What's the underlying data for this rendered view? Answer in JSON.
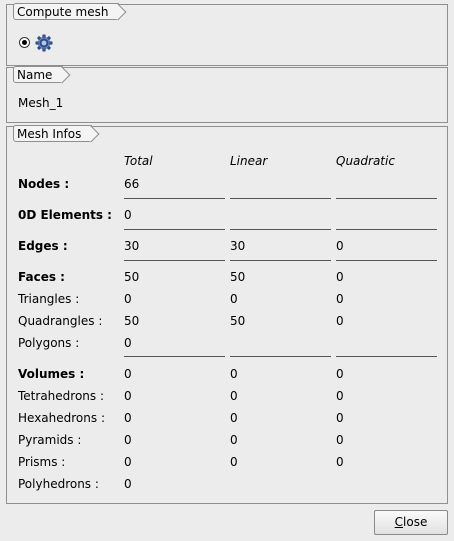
{
  "compute_mesh": {
    "title": "Compute mesh",
    "radio_selected": true,
    "icon": "gear-icon"
  },
  "name_group": {
    "title": "Name",
    "value": "Mesh_1"
  },
  "mesh_infos": {
    "title": "Mesh Infos",
    "headers": {
      "total": "Total",
      "linear": "Linear",
      "quadratic": "Quadratic"
    },
    "rows": {
      "nodes": {
        "label": "Nodes :",
        "total": "66",
        "linear": "",
        "quadratic": ""
      },
      "elements0d": {
        "label": "0D Elements :",
        "total": "0",
        "linear": "",
        "quadratic": ""
      },
      "edges": {
        "label": "Edges :",
        "total": "30",
        "linear": "30",
        "quadratic": "0"
      },
      "faces": {
        "label": "Faces :",
        "total": "50",
        "linear": "50",
        "quadratic": "0"
      },
      "triangles": {
        "label": "Triangles :",
        "total": "0",
        "linear": "0",
        "quadratic": "0"
      },
      "quadrangles": {
        "label": "Quadrangles :",
        "total": "50",
        "linear": "50",
        "quadratic": "0"
      },
      "polygons": {
        "label": "Polygons :",
        "total": "0",
        "linear": "",
        "quadratic": ""
      },
      "volumes": {
        "label": "Volumes :",
        "total": "0",
        "linear": "0",
        "quadratic": "0"
      },
      "tetrahedrons": {
        "label": "Tetrahedrons :",
        "total": "0",
        "linear": "0",
        "quadratic": "0"
      },
      "hexahedrons": {
        "label": "Hexahedrons :",
        "total": "0",
        "linear": "0",
        "quadratic": "0"
      },
      "pyramids": {
        "label": "Pyramids :",
        "total": "0",
        "linear": "0",
        "quadratic": "0"
      },
      "prisms": {
        "label": "Prisms :",
        "total": "0",
        "linear": "0",
        "quadratic": "0"
      },
      "polyhedrons": {
        "label": "Polyhedrons :",
        "total": "0",
        "linear": "",
        "quadratic": ""
      }
    }
  },
  "buttons": {
    "close_label_prefix": "C",
    "close_label_rest": "lose"
  }
}
